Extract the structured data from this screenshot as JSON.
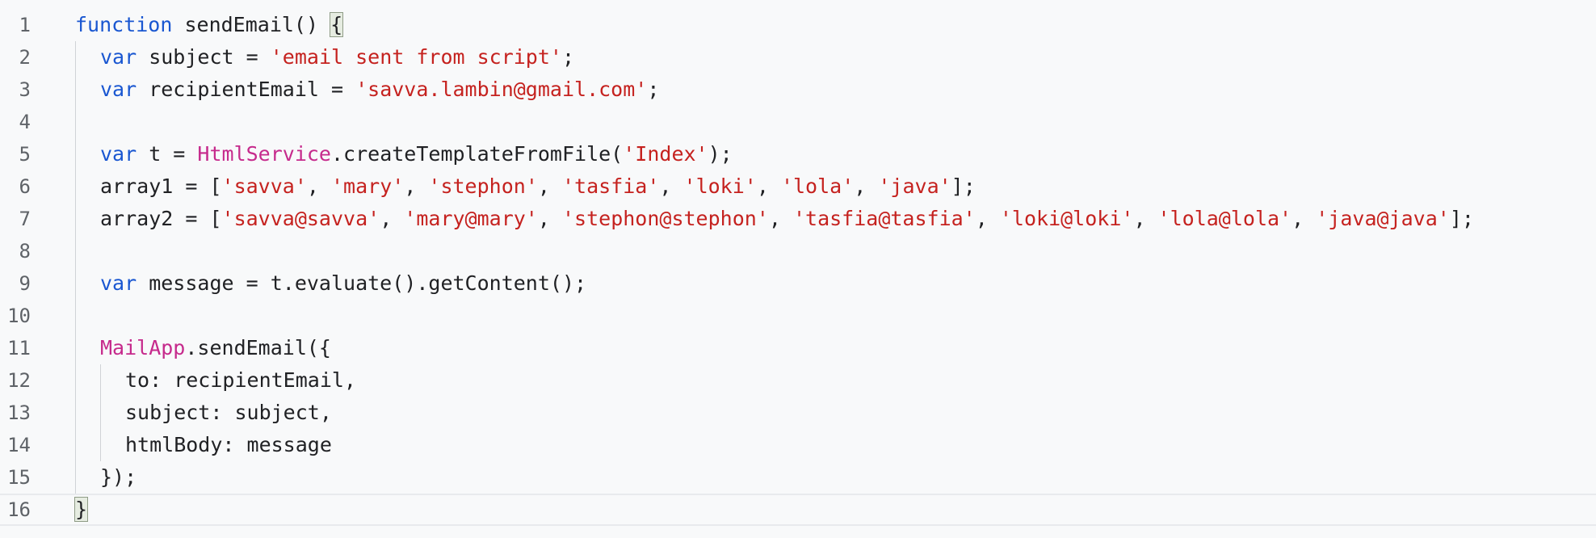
{
  "editor": {
    "lines": [
      {
        "num": "1",
        "indent": 0,
        "tokens": [
          {
            "t": "function",
            "c": "kw"
          },
          {
            "t": " sendEmail() ",
            "c": "plain"
          },
          {
            "t": "{",
            "c": "plain",
            "m": true
          }
        ]
      },
      {
        "num": "2",
        "indent": 1,
        "tokens": [
          {
            "t": "var",
            "c": "kw"
          },
          {
            "t": " subject = ",
            "c": "plain"
          },
          {
            "t": "'email sent from script'",
            "c": "str"
          },
          {
            "t": ";",
            "c": "plain"
          }
        ]
      },
      {
        "num": "3",
        "indent": 1,
        "tokens": [
          {
            "t": "var",
            "c": "kw"
          },
          {
            "t": " recipientEmail = ",
            "c": "plain"
          },
          {
            "t": "'savva.lambin@gmail.com'",
            "c": "str"
          },
          {
            "t": ";",
            "c": "plain"
          }
        ]
      },
      {
        "num": "4",
        "indent": 1,
        "tokens": []
      },
      {
        "num": "5",
        "indent": 1,
        "tokens": [
          {
            "t": "var",
            "c": "kw"
          },
          {
            "t": " t = ",
            "c": "plain"
          },
          {
            "t": "HtmlService",
            "c": "cls"
          },
          {
            "t": ".createTemplateFromFile(",
            "c": "plain"
          },
          {
            "t": "'Index'",
            "c": "str"
          },
          {
            "t": ");",
            "c": "plain"
          }
        ]
      },
      {
        "num": "6",
        "indent": 1,
        "tokens": [
          {
            "t": "array1 = [",
            "c": "plain"
          },
          {
            "t": "'savva'",
            "c": "str"
          },
          {
            "t": ", ",
            "c": "plain"
          },
          {
            "t": "'mary'",
            "c": "str"
          },
          {
            "t": ", ",
            "c": "plain"
          },
          {
            "t": "'stephon'",
            "c": "str"
          },
          {
            "t": ", ",
            "c": "plain"
          },
          {
            "t": "'tasfia'",
            "c": "str"
          },
          {
            "t": ", ",
            "c": "plain"
          },
          {
            "t": "'loki'",
            "c": "str"
          },
          {
            "t": ", ",
            "c": "plain"
          },
          {
            "t": "'lola'",
            "c": "str"
          },
          {
            "t": ", ",
            "c": "plain"
          },
          {
            "t": "'java'",
            "c": "str"
          },
          {
            "t": "];",
            "c": "plain"
          }
        ]
      },
      {
        "num": "7",
        "indent": 1,
        "tokens": [
          {
            "t": "array2 = [",
            "c": "plain"
          },
          {
            "t": "'savva@savva'",
            "c": "str"
          },
          {
            "t": ", ",
            "c": "plain"
          },
          {
            "t": "'mary@mary'",
            "c": "str"
          },
          {
            "t": ", ",
            "c": "plain"
          },
          {
            "t": "'stephon@stephon'",
            "c": "str"
          },
          {
            "t": ", ",
            "c": "plain"
          },
          {
            "t": "'tasfia@tasfia'",
            "c": "str"
          },
          {
            "t": ", ",
            "c": "plain"
          },
          {
            "t": "'loki@loki'",
            "c": "str"
          },
          {
            "t": ", ",
            "c": "plain"
          },
          {
            "t": "'lola@lola'",
            "c": "str"
          },
          {
            "t": ", ",
            "c": "plain"
          },
          {
            "t": "'java@java'",
            "c": "str"
          },
          {
            "t": "];",
            "c": "plain"
          }
        ]
      },
      {
        "num": "8",
        "indent": 1,
        "tokens": []
      },
      {
        "num": "9",
        "indent": 1,
        "tokens": [
          {
            "t": "var",
            "c": "kw"
          },
          {
            "t": " message = t.evaluate().getContent();",
            "c": "plain"
          }
        ]
      },
      {
        "num": "10",
        "indent": 1,
        "tokens": []
      },
      {
        "num": "11",
        "indent": 1,
        "tokens": [
          {
            "t": "MailApp",
            "c": "cls"
          },
          {
            "t": ".sendEmail({",
            "c": "plain"
          }
        ]
      },
      {
        "num": "12",
        "indent": 2,
        "tokens": [
          {
            "t": "to: recipientEmail,",
            "c": "plain"
          }
        ]
      },
      {
        "num": "13",
        "indent": 2,
        "tokens": [
          {
            "t": "subject: subject,",
            "c": "plain"
          }
        ]
      },
      {
        "num": "14",
        "indent": 2,
        "tokens": [
          {
            "t": "htmlBody: message",
            "c": "plain"
          }
        ]
      },
      {
        "num": "15",
        "indent": 1,
        "tokens": [
          {
            "t": "});",
            "c": "plain"
          }
        ]
      },
      {
        "num": "16",
        "indent": 0,
        "current": true,
        "tokens": [
          {
            "t": "}",
            "c": "plain",
            "m": true
          }
        ]
      }
    ]
  }
}
